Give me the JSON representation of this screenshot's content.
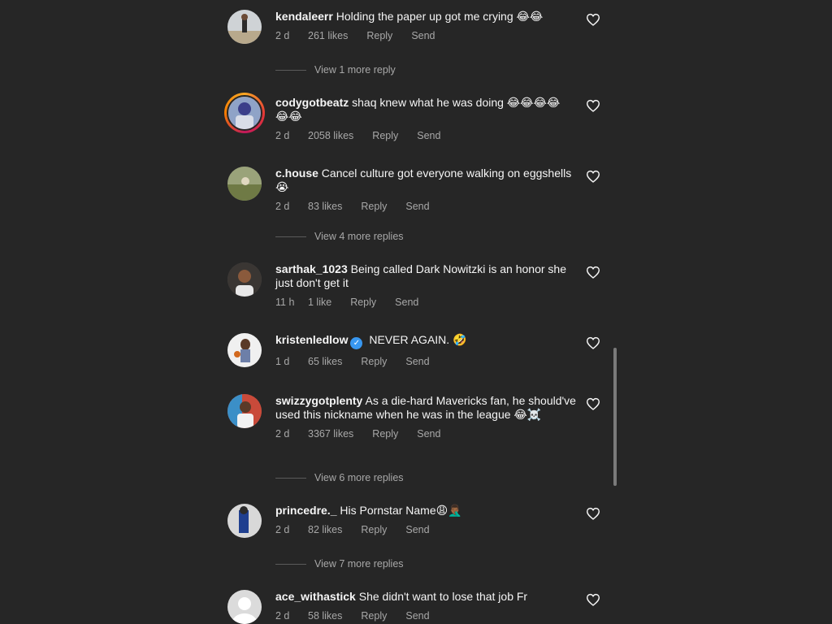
{
  "comments": [
    {
      "username": "kendaleerr",
      "text": "Holding the paper up got me crying 😂😂",
      "time": "2 d",
      "likes": "261 likes",
      "reply": "Reply",
      "send": "Send",
      "view_more": "View 1 more reply"
    },
    {
      "username": "codygotbeatz",
      "text": "shaq knew what he was doing 😂😂😂😂 😂😂",
      "time": "2 d",
      "likes": "2058 likes",
      "reply": "Reply",
      "send": "Send"
    },
    {
      "username": "c.house",
      "text": "Cancel culture got everyone walking on eggshells😭",
      "time": "2 d",
      "likes": "83 likes",
      "reply": "Reply",
      "send": "Send",
      "view_more": "View 4 more replies"
    },
    {
      "username": "sarthak_1023",
      "text": "Being called Dark Nowitzki is an honor she just don't get it",
      "time": "11 h",
      "likes": "1 like",
      "reply": "Reply",
      "send": "Send"
    },
    {
      "username": "kristenledlow",
      "verified": true,
      "text": "NEVER AGAIN. 🤣",
      "time": "1 d",
      "likes": "65 likes",
      "reply": "Reply",
      "send": "Send"
    },
    {
      "username": "swizzygotplenty",
      "text": "As a die-hard Mavericks fan, he should've used this nickname when he was in the league 😂☠️",
      "time": "2 d",
      "likes": "3367 likes",
      "reply": "Reply",
      "send": "Send",
      "view_more": "View 6 more replies"
    },
    {
      "username": "princedre._",
      "text": "His Pornstar Name😩🤦🏾‍♂️",
      "time": "2 d",
      "likes": "82 likes",
      "reply": "Reply",
      "send": "Send",
      "view_more": "View 7 more replies"
    },
    {
      "username": "ace_withastick",
      "text": "She didn't want to lose that job Fr",
      "time": "2 d",
      "likes": "58 likes",
      "reply": "Reply",
      "send": "Send"
    }
  ],
  "icons": {
    "like": "heart-outline-icon",
    "verified": "verified-badge-icon"
  },
  "colors": {
    "background": "#262626",
    "text": "#f5f5f5",
    "meta": "#a8a8a8",
    "verified": "#3897f0"
  }
}
